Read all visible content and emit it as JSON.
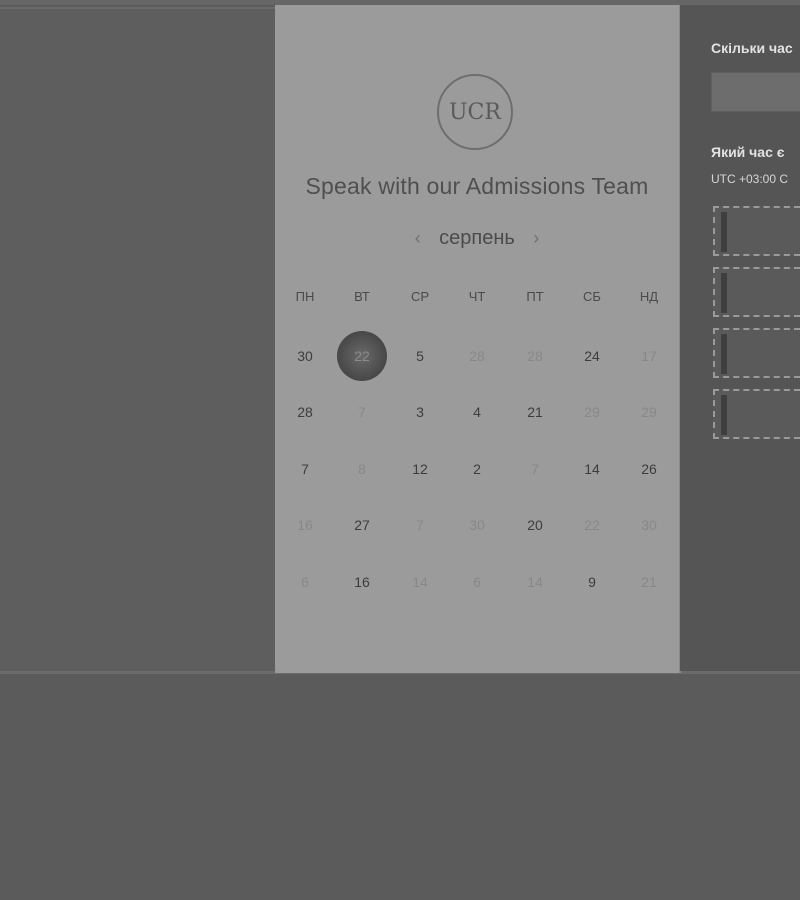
{
  "card": {
    "logo_text": "UCR",
    "title": "Speak with our Admissions Team",
    "month": "серпень",
    "prev_icon": "‹",
    "next_icon": "›",
    "weekdays": [
      "ПН",
      "ВТ",
      "СР",
      "ЧТ",
      "ПТ",
      "СБ",
      "НД"
    ],
    "weeks": [
      [
        {
          "d": "30",
          "s": "on"
        },
        {
          "d": "22",
          "s": "sel"
        },
        {
          "d": "5",
          "s": "on"
        },
        {
          "d": "28",
          "s": "off"
        },
        {
          "d": "28",
          "s": "off"
        },
        {
          "d": "24",
          "s": "on"
        },
        {
          "d": "17",
          "s": "off"
        }
      ],
      [
        {
          "d": "28",
          "s": "on"
        },
        {
          "d": "7",
          "s": "off"
        },
        {
          "d": "3",
          "s": "on"
        },
        {
          "d": "4",
          "s": "on"
        },
        {
          "d": "21",
          "s": "on"
        },
        {
          "d": "29",
          "s": "off"
        },
        {
          "d": "29",
          "s": "off"
        }
      ],
      [
        {
          "d": "7",
          "s": "on"
        },
        {
          "d": "8",
          "s": "off"
        },
        {
          "d": "12",
          "s": "on"
        },
        {
          "d": "2",
          "s": "on"
        },
        {
          "d": "7",
          "s": "off"
        },
        {
          "d": "14",
          "s": "on"
        },
        {
          "d": "26",
          "s": "on"
        }
      ],
      [
        {
          "d": "16",
          "s": "off"
        },
        {
          "d": "27",
          "s": "on"
        },
        {
          "d": "7",
          "s": "off"
        },
        {
          "d": "30",
          "s": "off"
        },
        {
          "d": "20",
          "s": "on"
        },
        {
          "d": "22",
          "s": "off"
        },
        {
          "d": "30",
          "s": "off"
        }
      ],
      [
        {
          "d": "6",
          "s": "off"
        },
        {
          "d": "16",
          "s": "on"
        },
        {
          "d": "14",
          "s": "off"
        },
        {
          "d": "6",
          "s": "off"
        },
        {
          "d": "14",
          "s": "off"
        },
        {
          "d": "9",
          "s": "on"
        },
        {
          "d": "21",
          "s": "off"
        }
      ]
    ]
  },
  "right": {
    "duration_label": "Скільки час",
    "time_label": "Який час є",
    "timezone": "UTC +03:00 С"
  }
}
